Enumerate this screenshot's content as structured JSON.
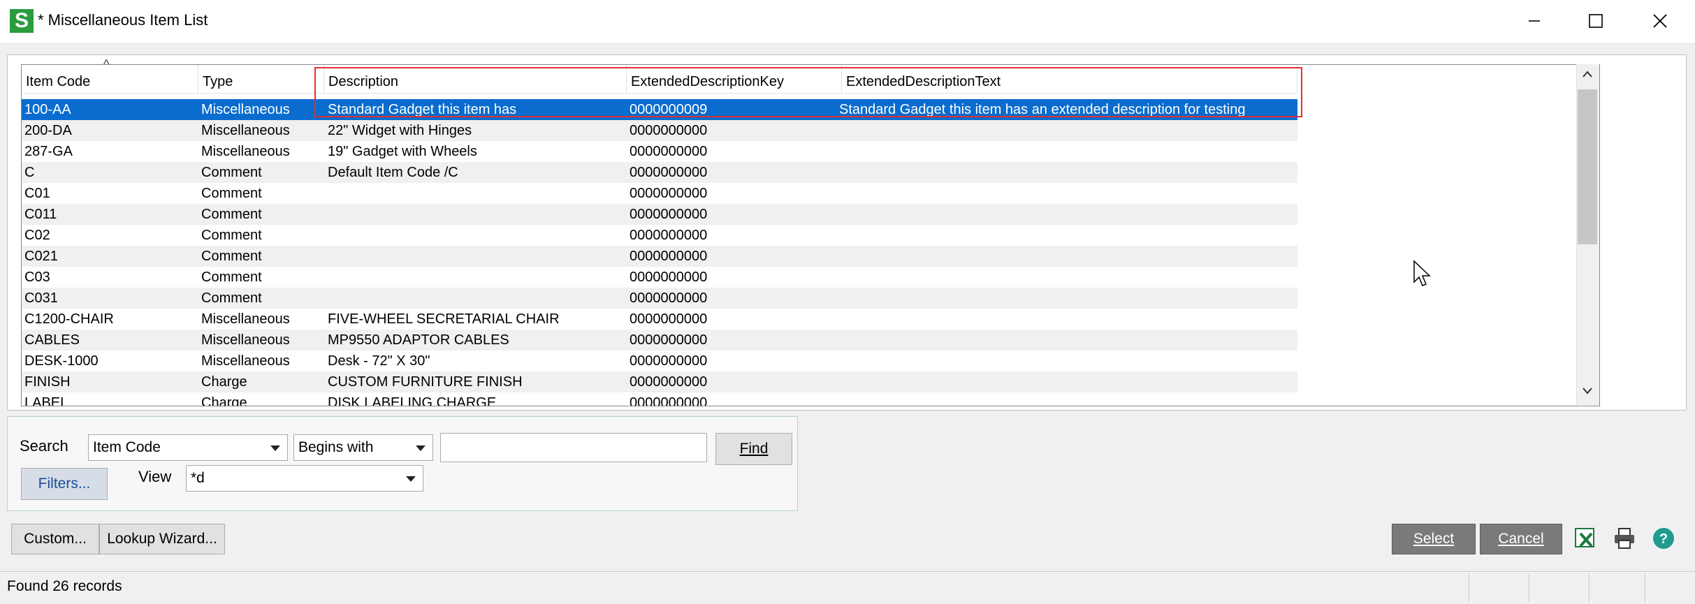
{
  "window": {
    "logo_letter": "S",
    "title": "* Miscellaneous Item List"
  },
  "grid": {
    "columns": [
      "Item Code",
      "Type",
      "Description",
      "ExtendedDescriptionKey",
      "ExtendedDescriptionText"
    ],
    "sort_indicator": "^",
    "rows": [
      [
        "100-AA",
        "Miscellaneous",
        "Standard Gadget  this item has",
        "0000000009",
        "Standard Gadget  this item has an extended description for testing"
      ],
      [
        "200-DA",
        "Miscellaneous",
        "22\" Widget with Hinges",
        "0000000000",
        ""
      ],
      [
        "287-GA",
        "Miscellaneous",
        "19\" Gadget with Wheels",
        "0000000000",
        ""
      ],
      [
        "C",
        "Comment",
        "Default Item Code /C",
        "0000000000",
        ""
      ],
      [
        "C01",
        "Comment",
        "",
        "0000000000",
        ""
      ],
      [
        "C011",
        "Comment",
        "",
        "0000000000",
        ""
      ],
      [
        "C02",
        "Comment",
        "",
        "0000000000",
        ""
      ],
      [
        "C021",
        "Comment",
        "",
        "0000000000",
        ""
      ],
      [
        "C03",
        "Comment",
        "",
        "0000000000",
        ""
      ],
      [
        "C031",
        "Comment",
        "",
        "0000000000",
        ""
      ],
      [
        "C1200-CHAIR",
        "Miscellaneous",
        "FIVE-WHEEL SECRETARIAL CHAIR",
        "0000000000",
        ""
      ],
      [
        "CABLES",
        "Miscellaneous",
        "MP9550 ADAPTOR CABLES",
        "0000000000",
        ""
      ],
      [
        "DESK-1000",
        "Miscellaneous",
        "Desk - 72\" X 30\"",
        "0000000000",
        ""
      ],
      [
        "FINISH",
        "Charge",
        "CUSTOM FURNITURE FINISH",
        "0000000000",
        ""
      ],
      [
        "LABEL",
        "Charge",
        "DISK LABELING CHARGE",
        "0000000000",
        ""
      ]
    ],
    "selected_row": 0
  },
  "search": {
    "search_label": "Search",
    "field_value": "Item Code",
    "operator_value": "Begins with",
    "text_value": "",
    "find_label": "Find",
    "filters_label": "Filters...",
    "view_label": "View",
    "view_value": "*d"
  },
  "buttons": {
    "custom_label": "Custom...",
    "lookup_wizard_label": "Lookup Wizard...",
    "select_label": "Select",
    "cancel_label": "Cancel"
  },
  "status": {
    "text": "Found 26 records"
  },
  "colors": {
    "selection": "#0a6cce",
    "highlight_box": "#e03030",
    "logo": "#2a9c3f"
  }
}
